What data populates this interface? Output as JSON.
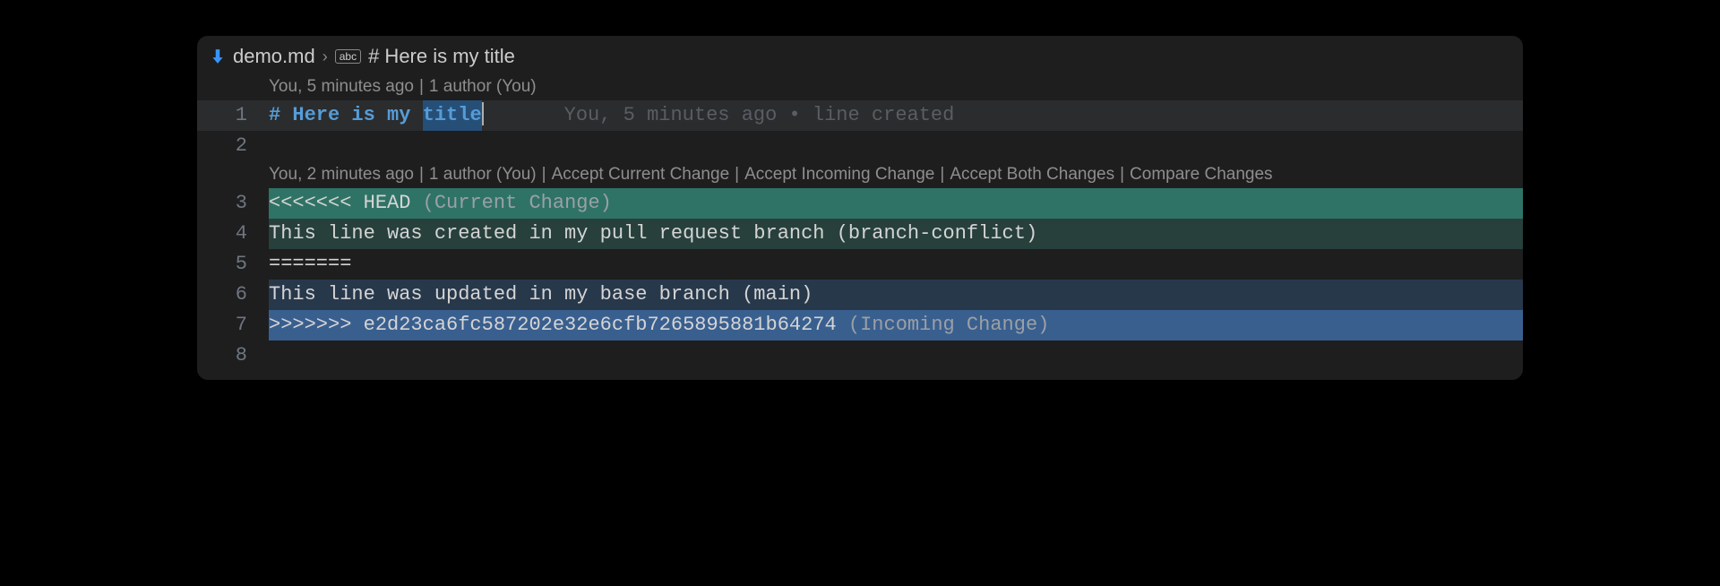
{
  "breadcrumb": {
    "file": "demo.md",
    "symbol": "# Here is my title"
  },
  "codelens1": {
    "blame": "You, 5 minutes ago",
    "authors": "1 author (You)"
  },
  "line1": {
    "prefix": "# Here is my ",
    "selected": "title",
    "blame": "You, 5 minutes ago • line created"
  },
  "codelens3": {
    "blame": "You, 2 minutes ago",
    "authors": "1 author (You)",
    "acceptCurrent": "Accept Current Change",
    "acceptIncoming": "Accept Incoming Change",
    "acceptBoth": "Accept Both Changes",
    "compare": "Compare Changes"
  },
  "lines": {
    "l3_marker": "<<<<<<< HEAD",
    "l3_label": " (Current Change)",
    "l4": "This line was created in my pull request branch (branch-conflict)",
    "l5": "=======",
    "l6": "This line was updated in my base branch (main)",
    "l7_marker": ">>>>>>> e2d23ca6fc587202e32e6cfb7265895881b64274",
    "l7_label": " (Incoming Change)"
  },
  "lineNumbers": {
    "n1": "1",
    "n2": "2",
    "n3": "3",
    "n4": "4",
    "n5": "5",
    "n6": "6",
    "n7": "7",
    "n8": "8"
  }
}
